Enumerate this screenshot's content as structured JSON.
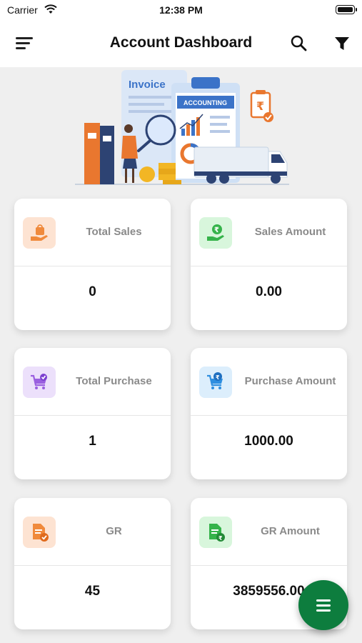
{
  "status_bar": {
    "carrier": "Carrier",
    "time": "12:38 PM"
  },
  "header": {
    "title": "Account Dashboard"
  },
  "banner": {
    "invoice_label": "Invoice",
    "accounting_label": "ACCOUNTING"
  },
  "cards": [
    {
      "label": "Total Sales",
      "value": "0",
      "icon": "shopping-bag-hand-icon",
      "icon_bg": "#fde3d2",
      "icon_color": "#f08a3c"
    },
    {
      "label": "Sales Amount",
      "value": "0.00",
      "icon": "rupee-hand-icon",
      "icon_bg": "#d8f6dc",
      "icon_color": "#35b34a"
    },
    {
      "label": "Total Purchase",
      "value": "1",
      "icon": "cart-check-icon",
      "icon_bg": "#ece0fb",
      "icon_color": "#9a5fe0"
    },
    {
      "label": "Purchase Amount",
      "value": "1000.00",
      "icon": "cart-rupee-icon",
      "icon_bg": "#dceefc",
      "icon_color": "#2f8fe0"
    },
    {
      "label": "GR",
      "value": "45",
      "icon": "document-check-icon",
      "icon_bg": "#fde3d2",
      "icon_color": "#f08a3c"
    },
    {
      "label": "GR Amount",
      "value": "3859556.00",
      "icon": "document-rupee-icon",
      "icon_bg": "#d8f6dc",
      "icon_color": "#35b34a"
    }
  ],
  "colors": {
    "fab": "#0d7d3e",
    "background": "#efefef",
    "label": "#8a8a8a"
  }
}
